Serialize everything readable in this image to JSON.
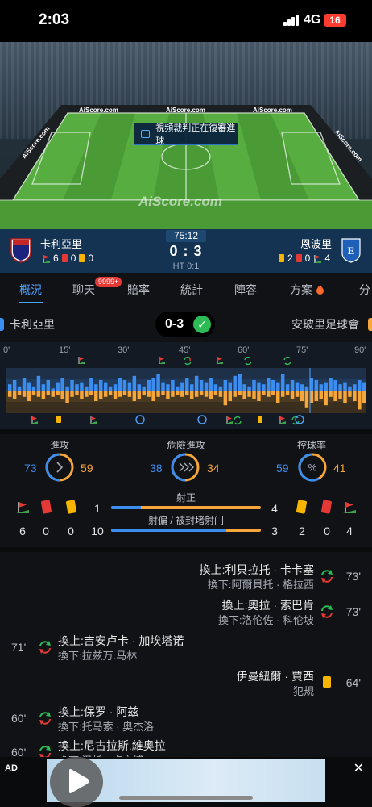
{
  "status_bar": {
    "time": "2:03",
    "network": "4G",
    "battery": "16"
  },
  "pitch": {
    "ads": [
      "AiScore.com",
      "AiScore.com",
      "AiScore.com",
      "AiScore.com",
      "AiScore.com"
    ],
    "var_notice": "視頻裁判正在復審進球",
    "watermark": "AiScore.com"
  },
  "match": {
    "home": {
      "name": "卡利亞里",
      "corners": "6",
      "red": "0",
      "yellow": "0"
    },
    "away": {
      "name": "恩波里",
      "yellow": "2",
      "red": "0",
      "corners": "4"
    },
    "clock": "75:12",
    "score": "0 : 3",
    "halftime": "HT 0:1"
  },
  "tabs": [
    {
      "label": "概況",
      "active": true
    },
    {
      "label": "聊天",
      "badge": "9999+"
    },
    {
      "label": "賠率"
    },
    {
      "label": "統計"
    },
    {
      "label": "陣容"
    },
    {
      "label": "方案"
    },
    {
      "label": "分"
    }
  ],
  "summary": {
    "home": "卡利亞里",
    "score": "0-3",
    "away": "安玻里足球會"
  },
  "timeline": {
    "ticks": [
      "0'",
      "15'",
      "30'",
      "45'",
      "60'",
      "75'",
      "90'"
    ],
    "pressure_home": [
      0.3,
      0.5,
      0.2,
      0.6,
      0.4,
      0.2,
      0.7,
      0.3,
      0.5,
      0.1,
      0.4,
      0.6,
      0.2,
      0.5,
      0.3,
      0.4,
      0.2,
      0.6,
      0.3,
      0.5,
      0.4,
      0.2,
      0.3,
      0.6,
      0.5,
      0.4,
      0.7,
      0.3,
      0.2,
      0.5,
      0.6,
      0.8,
      0.4,
      0.3,
      0.5,
      0.2,
      0.4,
      0.6,
      0.3,
      0.7,
      0.5,
      0.4,
      0.6,
      0.3,
      0.2,
      0.5,
      0.4,
      0.7,
      0.8,
      0.3,
      0.2,
      0.5,
      0.4,
      0.3,
      0.6,
      0.5,
      0.4,
      0.8,
      0.3,
      0.5,
      0.4,
      0.3,
      0.2,
      0.6,
      0.5,
      0.3,
      0.4,
      0.6,
      0.5,
      0.3,
      0.4,
      0.2,
      0.3,
      0.5,
      0.4
    ],
    "pressure_away": [
      0.3,
      0.4,
      0.2,
      0.3,
      0.5,
      0.2,
      0.3,
      0.4,
      0.2,
      0.3,
      0.2,
      0.4,
      0.6,
      0.3,
      0.2,
      0.4,
      0.3,
      0.2,
      0.5,
      0.4,
      0.3,
      0.2,
      0.4,
      0.3,
      0.2,
      0.3,
      0.5,
      0.4,
      0.2,
      0.3,
      0.5,
      0.3,
      0.2,
      0.4,
      0.3,
      0.2,
      0.3,
      0.2,
      0.4,
      0.3,
      0.2,
      0.3,
      0.4,
      0.2,
      0.3,
      0.7,
      0.5,
      0.3,
      0.2,
      0.4,
      0.3,
      0.4,
      0.5,
      0.2,
      0.3,
      0.2,
      0.6,
      0.3,
      0.2,
      0.4,
      0.3,
      0.5,
      0.8,
      0.6,
      0.5,
      0.4,
      0.7,
      0.3,
      0.5,
      0.4,
      0.6,
      0.3,
      0.5,
      0.9,
      0.6
    ]
  },
  "stats": {
    "attacks": {
      "label": "進攻",
      "home": "73",
      "away": "59"
    },
    "dangerous": {
      "label": "危險進攻",
      "home": "38",
      "away": "34"
    },
    "possession": {
      "label": "控球率",
      "home": "59",
      "away": "41"
    },
    "home_corners": "6",
    "home_red": "0",
    "home_yellow": "0",
    "away_yellow": "2",
    "away_red": "0",
    "away_corners": "4",
    "on_target": {
      "label": "射正",
      "home": "1",
      "away": "4",
      "home_share": 0.2
    },
    "off_target": {
      "label": "射偏 / 被封堵射门",
      "home": "10",
      "away": "3",
      "home_share": 0.77
    }
  },
  "events": [
    {
      "side": "away",
      "minute": "73'",
      "in": "換上:利貝拉托 · 卡卡塞",
      "out": "換下:阿爾貝托 · 格拉西"
    },
    {
      "side": "away",
      "minute": "73'",
      "in": "換上:奧拉 · 索巴肯",
      "out": "換下:洛伦佐 · 科伦坡"
    },
    {
      "side": "home",
      "minute": "71'",
      "in": "換上:吉安卢卡 · 加埃塔诺",
      "out": "換下:拉兹万.马林"
    },
    {
      "side": "away",
      "minute": "64'",
      "player": "伊曼紐爾 · 賈西",
      "detail": "犯規"
    },
    {
      "side": "home",
      "minute": "60'",
      "in": "換上:保罗 · 阿兹",
      "out": "換下:托马索 · 奥杰洛"
    },
    {
      "side": "home",
      "minute": "60'",
      "in": "換上:尼古拉斯.維奥拉",
      "out": "換下:泽托 · 卢文博"
    }
  ],
  "ad": {
    "label": "AD",
    "close": "✕"
  }
}
